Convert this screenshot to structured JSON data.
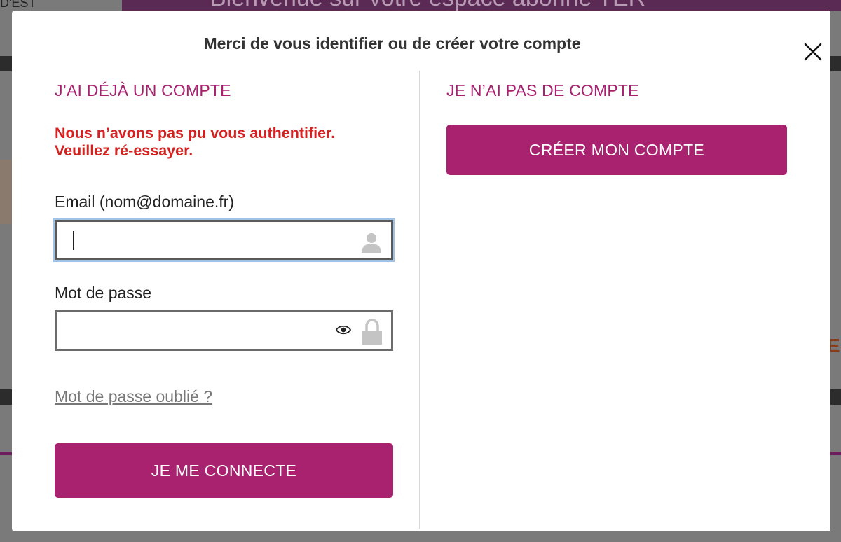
{
  "background": {
    "banner_text": "Bienvenue sur votre espace abonné TER",
    "left_text": "D'EST",
    "right_glyph": "E"
  },
  "modal": {
    "title": "Merci de vous identifier ou de créer votre compte",
    "close_glyph": "×"
  },
  "login": {
    "heading": "J’AI DÉJÀ UN COMPTE",
    "error_line1": "Nous n’avons pas pu vous authentifier.",
    "error_line2": "Veuillez ré-essayer.",
    "email_label": "Email (nom@domaine.fr)",
    "email_value": "",
    "password_label": "Mot de passe",
    "password_value": "",
    "forgot_link": "Mot de passe oublié ?",
    "submit_label": "JE ME CONNECTE"
  },
  "signup": {
    "heading": "JE N’AI PAS DE COMPTE",
    "create_label": "CRÉER MON COMPTE"
  },
  "colors": {
    "accent": "#a8226f",
    "error": "#d62121",
    "focus_ring": "#9ec3e6"
  }
}
